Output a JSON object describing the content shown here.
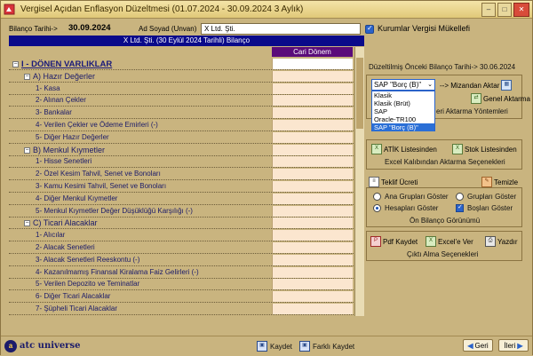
{
  "window": {
    "title": "Vergisel Açıdan Enflasyon Düzeltmesi (01.07.2024 - 30.09.2024 3 Aylık)",
    "buttons": {
      "minimize": "–",
      "maximize": "□",
      "close": "✕"
    }
  },
  "form": {
    "bilanco_label": "Bilanço Tarihi->",
    "bilanco_value": "30.09.2024",
    "ad_soyad_label": "Ad Soyad (Unvan)",
    "ad_soyad_value": "X Ltd. Şti.",
    "kurumlar_label": "Kurumlar Vergisi Mükellefi",
    "kurumlar_checked": true
  },
  "banner": "X Ltd. Şti. (30 Eylül 2024 Tarihli) Bilanço",
  "column_header": "Cari Dönem",
  "rows": [
    {
      "label": "I - DÖNEN VARLIKLAR",
      "level": "top"
    },
    {
      "label": "A) Hazır Değerler",
      "level": "group"
    },
    {
      "label": "1- Kasa",
      "level": "item"
    },
    {
      "label": "2- Alınan Çekler",
      "level": "item"
    },
    {
      "label": "3- Bankalar",
      "level": "item"
    },
    {
      "label": "4- Verilen Çekler ve Ödeme Emirleri (-)",
      "level": "item"
    },
    {
      "label": "5- Diğer Hazır Değerler",
      "level": "item"
    },
    {
      "label": "B) Menkul Kıymetler",
      "level": "group"
    },
    {
      "label": "1- Hisse Senetleri",
      "level": "item"
    },
    {
      "label": "2- Özel Kesim Tahvil, Senet ve Bonoları",
      "level": "item"
    },
    {
      "label": "3- Kamu Kesimi Tahvil, Senet ve Bonoları",
      "level": "item"
    },
    {
      "label": "4- Diğer Menkul Kıymetler",
      "level": "item"
    },
    {
      "label": "5- Menkul Kıymetler Değer Düşüklüğü Karşılığı (-)",
      "level": "item"
    },
    {
      "label": "C) Ticari Alacaklar",
      "level": "group"
    },
    {
      "label": "1- Alıcılar",
      "level": "item"
    },
    {
      "label": "2- Alacak Senetleri",
      "level": "item"
    },
    {
      "label": "3- Alacak Senetleri Reeskontu (-)",
      "level": "item"
    },
    {
      "label": "4- Kazanılmamış Finansal Kiralama Faiz Gelirleri (-)",
      "level": "item"
    },
    {
      "label": "5- Verilen Depozito ve Teminatlar",
      "level": "item"
    },
    {
      "label": "6- Diğer Ticari Alacaklar",
      "level": "item"
    },
    {
      "label": "7- Şüpheli Ticari Alacaklar",
      "level": "item"
    }
  ],
  "right": {
    "prev_date_label": "Düzeltilmiş Önceki Bilanço Tarihi-> 30.06.2024",
    "select_value": "SAP \"Borç (B)\"",
    "select_options": [
      "Klasik",
      "Klasik (Brüt)",
      "SAP",
      "Oracle-TR100",
      "SAP \"Borç (B)\""
    ],
    "selected_option_index": 4,
    "mizandan_aktar": "--> Mizandan Aktar",
    "genel_aktarma": "Genel Aktarma",
    "aktarma_yontemleri": "eri Aktarma Yöntemleri",
    "atik_listesinden": "ATİK Listesinden",
    "stok_listesinden": "Stok Listesinden",
    "excel_kalibindan": "Excel Kalıbından  Aktarma Seçenekleri",
    "teklif_ucreti": "Teklif Ücreti",
    "temizle": "Temizle",
    "ana_gruplari": "Ana Grupları Göster",
    "gruplari": "Grupları Göster",
    "hesaplari": "Hesapları Göster",
    "boslari": "Boşları Göster",
    "onceki_bilanco": "Ön Bilanço Görünümü",
    "pdf_kaydet": "Pdf Kaydet",
    "excel_ver": "Excel'e Ver",
    "yazdir": "Yazdır",
    "cikti_alma": "Çıktı Alma Seçenekleri"
  },
  "bottom": {
    "logo_text": "atc universe",
    "kaydet": "Kaydet",
    "farkli_kaydet": "Farklı Kaydet",
    "geri": "Geri",
    "ileri": "İleri"
  }
}
